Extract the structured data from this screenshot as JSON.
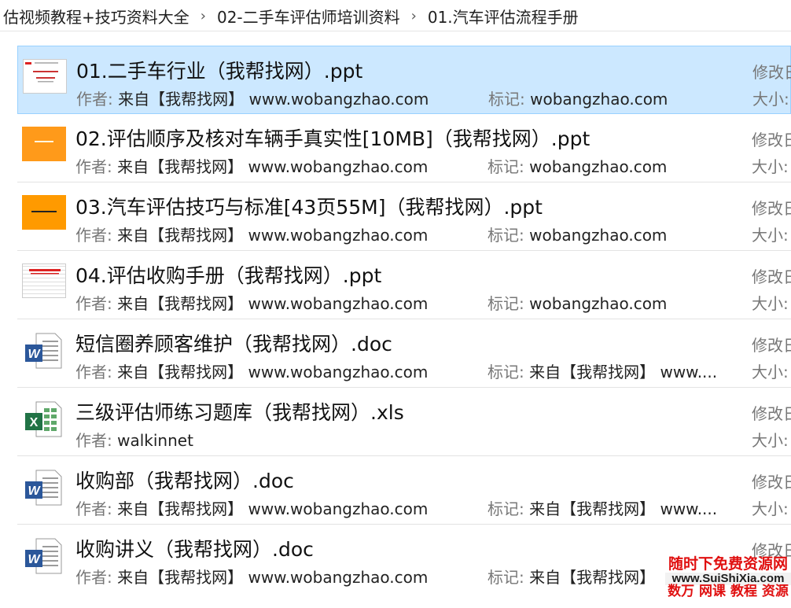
{
  "breadcrumb": [
    "估视频教程+技巧资料大全",
    "02-二手车评估师培训资料",
    "01.汽车评估流程手册"
  ],
  "breadcrumb_separator": "›",
  "meta_labels": {
    "author": "作者:",
    "tag": "标记:",
    "size": "大小:",
    "modified": "修改日"
  },
  "files": [
    {
      "name": "01.二手车行业（我帮找网）.ppt",
      "author": "来自【我帮找网】 www.wobangzhao.com",
      "tag": "wobangzhao.com",
      "icon": "ppt-slide-thumbnail-icon",
      "selected": true
    },
    {
      "name": "02.评估顺序及核对车辆手真实性[10MB]（我帮找网）.ppt",
      "author": "来自【我帮找网】 www.wobangzhao.com",
      "tag": "wobangzhao.com",
      "icon": "ppt-slide-thumbnail-icon"
    },
    {
      "name": "03.汽车评估技巧与标准[43页55M]（我帮找网）.ppt",
      "author": "来自【我帮找网】 www.wobangzhao.com",
      "tag": "wobangzhao.com",
      "icon": "ppt-slide-thumbnail-icon"
    },
    {
      "name": "04.评估收购手册（我帮找网）.ppt",
      "author": "来自【我帮找网】 www.wobangzhao.com",
      "tag": "wobangzhao.com",
      "icon": "ppt-slide-thumbnail-icon"
    },
    {
      "name": "短信圈养顾客维护（我帮找网）.doc",
      "author": "来自【我帮找网】 www.wobangzhao.com",
      "tag": "来自【我帮找网】 www....",
      "icon": "word-doc-icon"
    },
    {
      "name": "三级评估师练习题库（我帮找网）.xls",
      "author": "walkinnet",
      "tag": "",
      "icon": "excel-xls-icon"
    },
    {
      "name": "收购部（我帮找网）.doc",
      "author": "来自【我帮找网】 www.wobangzhao.com",
      "tag": "来自【我帮找网】 www....",
      "icon": "word-doc-icon"
    },
    {
      "name": "收购讲义（我帮找网）.doc",
      "author": "来自【我帮找网】 www.wobangzhao.com",
      "tag": "来自【我帮找网】",
      "icon": "word-doc-icon"
    }
  ],
  "watermark": {
    "line1": "随时下免费资源网",
    "line2": "www.SuiShiXia.com",
    "line3": "数万 网课 教程 资源"
  },
  "colors": {
    "selected_bg": "#cce8ff",
    "selected_border": "#99d1ff",
    "word_blue": "#2b579a",
    "excel_green": "#217346",
    "ppt_orange": "#ff9a1a",
    "watermark_red": "#e01010"
  }
}
